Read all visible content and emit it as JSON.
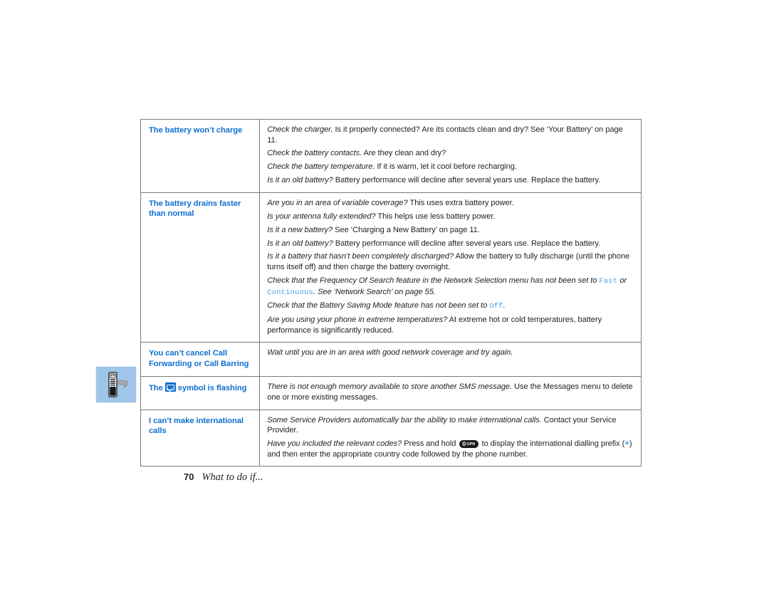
{
  "page": {
    "footer_page_number": "70",
    "footer_title": "What to do if...",
    "marker_icon": "phone-with-arrow-icon"
  },
  "colors": {
    "heading_blue": "#0d6fd0",
    "code_blue": "#4a9fe0",
    "marker_bg": "#9fc6e8",
    "border_gray": "#7a7a7a",
    "body_text": "#231f20"
  },
  "table": {
    "rows": [
      {
        "question": "The battery won’t charge",
        "answers": [
          {
            "lead": "Check the charger.",
            "rest": " Is it properly connected? Are its contacts clean and dry? See ‘Your Battery’ on page 11."
          },
          {
            "lead": "Check the battery contacts.",
            "rest": " Are they clean and dry?"
          },
          {
            "lead": "Check the battery temperature.",
            "rest": " If it is warm, let it cool before recharging."
          },
          {
            "lead": "Is it an old battery?",
            "rest": " Battery performance will decline after several years use. Replace the battery."
          }
        ]
      },
      {
        "question": "The battery drains faster than normal",
        "answers": [
          {
            "lead": "Are you in an area of variable coverage?",
            "rest": " This uses extra battery power."
          },
          {
            "lead": "Is your antenna fully extended?",
            "rest": " This helps use less battery power."
          },
          {
            "lead": "Is it a new battery?",
            "rest": " See ‘Charging a New Battery’ on page 11."
          },
          {
            "lead": "Is it an old battery?",
            "rest": " Battery performance will decline after several years use. Replace the battery."
          },
          {
            "lead": "Is it a battery that hasn’t been completely discharged?",
            "rest": " Allow the battery to fully discharge (until the phone turns itself off) and then charge the battery overnight."
          },
          {
            "lead_a": "Check that the Frequency Of Search feature in the Network Selection menu has not been set to ",
            "code_1": "Fast",
            "mid": " or ",
            "code_2": "Continuous",
            "lead_b": ". See ‘Network Search’ on page 55."
          },
          {
            "lead_a": "Check that the Battery Saving Mode feature has not been set to ",
            "code_1": "Off",
            "lead_b": "."
          },
          {
            "lead": "Are you using your phone in extreme temperatures?",
            "rest": " At extreme hot or cold temperatures, battery performance is significantly reduced."
          }
        ]
      },
      {
        "question": "You can’t cancel Call Forwarding or Call Barring",
        "answers": [
          {
            "lead": "Wait until you are in an area with good network coverage and try again.",
            "rest": ""
          }
        ]
      },
      {
        "question_before": "The",
        "question_icon": "envelope-icon",
        "question_after": "symbol is flashing",
        "answers": [
          {
            "lead": "There is not enough memory available to store another SMS message.",
            "rest": " Use the Messages menu to delete one or more existing messages."
          }
        ]
      },
      {
        "question": "I can’t make international calls",
        "answers": [
          {
            "lead": "Some Service Providers automatically bar the ability to make international calls.",
            "rest": " Contact your Service Provider."
          },
          {
            "lead_a": "Have you included the relevant codes?",
            "mid_a": " Press and hold ",
            "key_num": "0",
            "key_sub": "OPR",
            "mid_b": " to display the international dialling prefix (",
            "plus": "+",
            "mid_c": ") and then enter the appropriate country code followed by the phone number."
          }
        ]
      }
    ]
  }
}
